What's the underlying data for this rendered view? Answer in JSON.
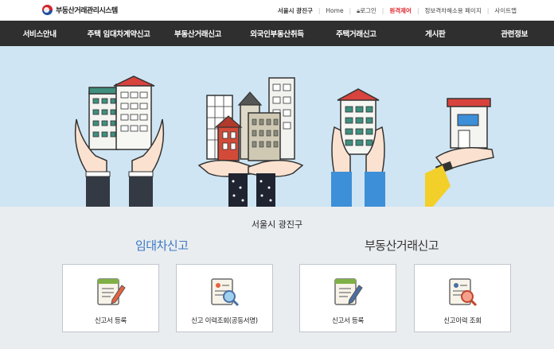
{
  "header": {
    "logo_text": "부동산거래관리시스템",
    "util": {
      "region": "서울시 광진구",
      "home": "Home",
      "login": "로그인",
      "remote": "원격제어",
      "accessibility": "정보격차해소용 페이지",
      "sitemap": "사이트맵"
    }
  },
  "nav": {
    "items": [
      "서비스안내",
      "주택 임대차계약신고",
      "부동산거래신고",
      "외국인부동산취득",
      "주택거래신고",
      "게시판",
      "관련정보"
    ]
  },
  "main": {
    "region_title": "서울시 광진구",
    "rent_title": "임대차신고",
    "real_title": "부동산거래신고",
    "cards": [
      {
        "label": "신고서 등록",
        "icon": "report-write-icon"
      },
      {
        "label": "신고 이력조회(공동서명)",
        "icon": "history-search-icon"
      },
      {
        "label": "신고서 등록",
        "icon": "report-write-icon"
      },
      {
        "label": "신고이력 조회",
        "icon": "history-search-icon"
      }
    ]
  },
  "colors": {
    "nav_bg": "#2f2f2f",
    "hero_bg": "#cfe5f3",
    "accent_blue": "#3a78c2",
    "remote_red": "#e0282e"
  }
}
